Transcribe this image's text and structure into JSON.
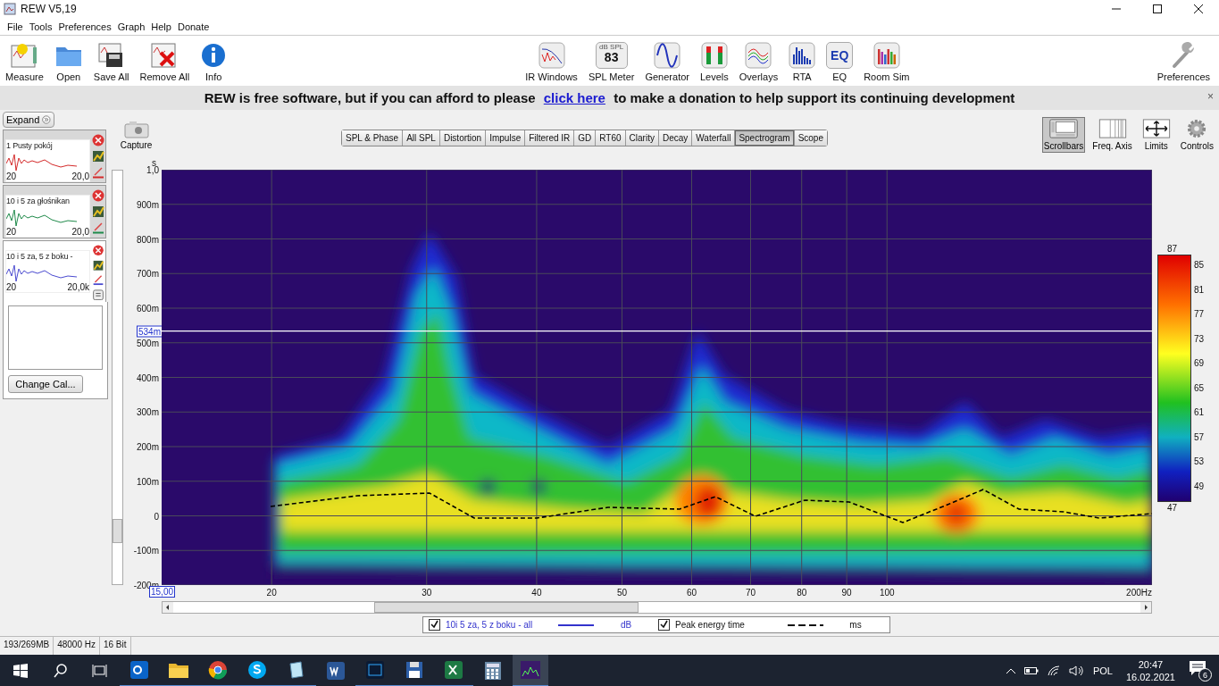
{
  "window": {
    "title": "REW V5,19"
  },
  "menu": [
    "File",
    "Tools",
    "Preferences",
    "Graph",
    "Help",
    "Donate"
  ],
  "toolbar_left": [
    {
      "label": "Measure",
      "kind": "measure"
    },
    {
      "label": "Open",
      "kind": "open"
    },
    {
      "label": "Save All",
      "kind": "save"
    },
    {
      "label": "Remove All",
      "kind": "remove"
    },
    {
      "label": "Info",
      "kind": "info"
    }
  ],
  "toolbar_center": [
    {
      "label": "IR Windows",
      "kind": "ir"
    },
    {
      "label": "SPL Meter",
      "kind": "spl",
      "icon_text": [
        "dB SPL",
        "83"
      ]
    },
    {
      "label": "Generator",
      "kind": "generator"
    },
    {
      "label": "Levels",
      "kind": "levels"
    },
    {
      "label": "Overlays",
      "kind": "overlays"
    },
    {
      "label": "RTA",
      "kind": "rta"
    },
    {
      "label": "EQ",
      "kind": "eq",
      "icon_text": [
        "EQ"
      ]
    },
    {
      "label": "Room Sim",
      "kind": "roomsim"
    }
  ],
  "toolbar_right": [
    {
      "label": "Preferences",
      "kind": "wrench"
    }
  ],
  "banner": {
    "before": "REW is free software, but if you can afford to please",
    "link": "click here",
    "after": "to make a donation to help support its continuing development",
    "close": "×"
  },
  "measurements_panel": {
    "expand": "Expand",
    "cards": [
      {
        "number": "1",
        "title": "Pusty pokój",
        "x_start": "20",
        "x_end": "20,0",
        "color": "#d42a2a",
        "selected": false,
        "ref_icon": false
      },
      {
        "number": "10",
        "title": "i 5 za głośnikan",
        "x_start": "20",
        "x_end": "20,0",
        "color": "#1f8a4a",
        "selected": false,
        "ref_icon": false
      },
      {
        "number": "10",
        "title": "i 5 za, 5 z boku -",
        "x_start": "20",
        "x_end": "20,0k",
        "color": "#4a4ad0",
        "selected": true,
        "ref_icon": true
      }
    ],
    "change_cal": "Change Cal..."
  },
  "graph": {
    "capture": "Capture",
    "tabs": [
      {
        "label": "SPL & Phase",
        "selected": false
      },
      {
        "label": "All SPL",
        "selected": false
      },
      {
        "label": "Distortion",
        "selected": false
      },
      {
        "label": "Impulse",
        "selected": false
      },
      {
        "label": "Filtered IR",
        "selected": false
      },
      {
        "label": "GD",
        "selected": false
      },
      {
        "label": "RT60",
        "selected": false
      },
      {
        "label": "Clarity",
        "selected": false
      },
      {
        "label": "Decay",
        "selected": false
      },
      {
        "label": "Waterfall",
        "selected": false
      },
      {
        "label": "Spectrogram",
        "selected": true
      },
      {
        "label": "Scope",
        "selected": false
      }
    ],
    "tools": [
      {
        "label": "Scrollbars",
        "kind": "scrollbars",
        "selected": true
      },
      {
        "label": "Freq. Axis",
        "kind": "freqaxis",
        "selected": false
      },
      {
        "label": "Limits",
        "kind": "limits",
        "selected": false
      },
      {
        "label": "Controls",
        "kind": "controls",
        "selected": false
      }
    ],
    "y_unit": "s",
    "y_ticks": [
      "1,0",
      "900m",
      "800m",
      "700m",
      "600m",
      "500m",
      "400m",
      "300m",
      "200m",
      "100m",
      "0",
      "-100m",
      "-200m"
    ],
    "cursor_y": "534m",
    "x_start": "15,00",
    "x_ticks": [
      "20",
      "30",
      "40",
      "50",
      "60",
      "70",
      "80",
      "90",
      "100",
      "200Hz"
    ],
    "color_scale": {
      "max": "87",
      "min": "47",
      "ticks": [
        "85",
        "81",
        "77",
        "73",
        "69",
        "65",
        "61",
        "57",
        "53",
        "49"
      ]
    },
    "legend": [
      {
        "kind": "measurement",
        "checked": true,
        "name": "10i 5 za, 5 z boku - all",
        "unit": "dB"
      },
      {
        "kind": "peak",
        "checked": true,
        "name": "Peak energy time",
        "unit": "ms"
      }
    ]
  },
  "status_bar": [
    "193/269MB",
    "48000 Hz",
    "16 Bit"
  ],
  "taskbar": {
    "apps": [
      {
        "kind": "outlook",
        "running": true,
        "selected": false
      },
      {
        "kind": "folder",
        "running": true,
        "selected": false
      },
      {
        "kind": "browser",
        "running": true,
        "selected": false
      },
      {
        "kind": "skype",
        "running": true,
        "selected": false
      },
      {
        "kind": "notepad",
        "running": true,
        "selected": false
      },
      {
        "kind": "word",
        "running": false,
        "selected": false
      },
      {
        "kind": "photoshop",
        "running": true,
        "selected": false
      },
      {
        "kind": "floppy",
        "running": true,
        "selected": false
      },
      {
        "kind": "excel",
        "running": true,
        "selected": false
      },
      {
        "kind": "calculator",
        "running": false,
        "selected": false
      },
      {
        "kind": "rew",
        "running": true,
        "selected": true
      }
    ],
    "tray": {
      "language": "POL",
      "time": "20:47",
      "date": "16.02.2021",
      "notifications": "6"
    }
  }
}
